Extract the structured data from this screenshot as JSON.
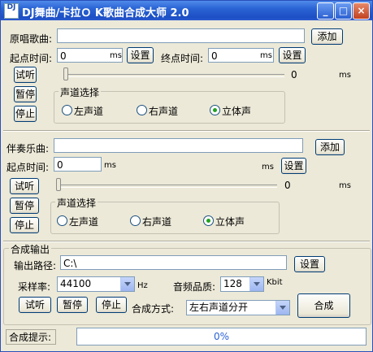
{
  "window": {
    "title": "DJ舞曲/卡拉Ｏ K歌曲合成大师 2.0",
    "icon_text": "DJ",
    "minimize_glyph": "_",
    "maximize_glyph": "□",
    "close_glyph": "×"
  },
  "original": {
    "song_label": "原唱歌曲:",
    "song_value": "",
    "add_label": "添加",
    "start_label": "起点时间:",
    "start_value": "0",
    "start_unit": "ms",
    "set_start_label": "设置",
    "end_label": "终点时间:",
    "end_value": "0",
    "end_unit": "ms",
    "set_end_label": "设置",
    "audition_label": "试听",
    "pause_label": "暂停",
    "stop_label": "停止",
    "position_value": "0",
    "position_unit": "ms",
    "channel_title": "声道选择",
    "channel_left": "左声道",
    "channel_right": "右声道",
    "channel_stereo": "立体声",
    "channel_selected": "stereo"
  },
  "accompaniment": {
    "song_label": "伴奏乐曲:",
    "song_value": "",
    "add_label": "添加",
    "start_label": "起点时间:",
    "start_value": "0",
    "start_unit": "ms",
    "end_unit": "ms",
    "set_label": "设置",
    "audition_label": "试听",
    "pause_label": "暂停",
    "stop_label": "停止",
    "position_value": "0",
    "position_unit": "ms",
    "channel_title": "声道选择",
    "channel_left": "左声道",
    "channel_right": "右声道",
    "channel_stereo": "立体声",
    "channel_selected": "stereo"
  },
  "output": {
    "group_title": "合成输出",
    "path_label": "输出路径:",
    "path_value": "C:\\",
    "path_set_label": "设置",
    "sample_rate_label": "采样率:",
    "sample_rate_value": "44100",
    "sample_rate_unit": "Hz",
    "quality_label": "音频品质:",
    "quality_value": "128",
    "quality_unit": "Kbit",
    "audition_label": "试听",
    "pause_label": "暂停",
    "stop_label": "停止",
    "mode_label": "合成方式:",
    "mode_value": "左右声道分开",
    "compose_label": "合成"
  },
  "status": {
    "hint_label": "合成提示:",
    "progress_text": "0%",
    "progress_value": 0
  }
}
